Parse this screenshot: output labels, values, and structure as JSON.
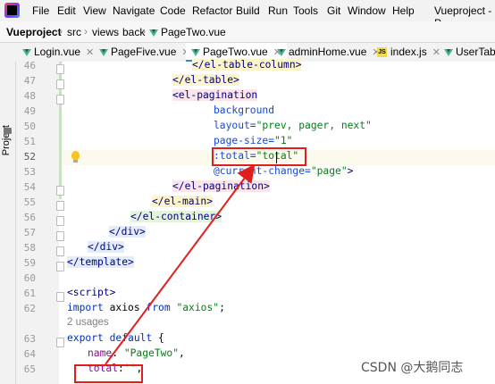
{
  "menu": {
    "items": [
      "File",
      "Edit",
      "View",
      "Navigate",
      "Code",
      "Refactor",
      "Build",
      "Run",
      "Tools",
      "Git",
      "Window",
      "Help"
    ],
    "window_title": "Vueproject - P"
  },
  "breadcrumb": {
    "project": "Vueproject",
    "parts": [
      "src",
      "views",
      "back"
    ],
    "file": "PageTwo.vue"
  },
  "tabs": [
    {
      "label": "Login.vue",
      "icon": "vue-file-icon"
    },
    {
      "label": "PageFive.vue",
      "icon": "vue-file-icon"
    },
    {
      "label": "PageTwo.vue",
      "icon": "vue-file-icon",
      "active": true
    },
    {
      "label": "adminHome.vue",
      "icon": "vue-file-icon"
    },
    {
      "label": "index.js",
      "icon": "js-file-icon"
    },
    {
      "label": "UserTabl",
      "icon": "vue-file-icon"
    }
  ],
  "sidebar": {
    "project_label": "Project"
  },
  "editor": {
    "line_numbers": [
      "46",
      "47",
      "48",
      "49",
      "50",
      "51",
      "52",
      "53",
      "54",
      "55",
      "56",
      "57",
      "58",
      "59",
      "60",
      "61",
      "62",
      "",
      "63",
      "64",
      "65"
    ],
    "current_line": "52",
    "code": {
      "l46": "</el-table-column>",
      "l47": "</el-table>",
      "l48_tag": "<el-pagination",
      "l49": "background",
      "l50_attr": "layout=",
      "l50_val": "\"prev, pager, next\"",
      "l51_attr": "page-size=",
      "l51_val": "\"1\"",
      "l52_attr": ":total=",
      "l52_val": "\"total\"",
      "l53_attr": "@current-change=",
      "l53_val": "\"page\"",
      "l53_end": ">",
      "l54": "</el-pagination>",
      "l55": "</el-main>",
      "l56": "</el-container>",
      "l57": "</div>",
      "l58": "</div>",
      "l59": "</template>",
      "l60": "",
      "l61": "<script>",
      "l62_kw1": "import",
      "l62_id": " axios ",
      "l62_kw2": "from",
      "l62_str": " \"axios\"",
      "l62_end": ";",
      "usages": "2 usages",
      "l63_kw1": "export",
      "l63_kw2": " default",
      "l63_end": " {",
      "l64_prop": "name",
      "l64_colon": ": ",
      "l64_str": "\"PageTwo\"",
      "l64_end": ",",
      "l65_prop": "total",
      "l65_colon": ":",
      "l65_str": "''",
      "l65_end": ","
    }
  },
  "annotation": {
    "color": "#e01e1e"
  },
  "watermark": "CSDN @大鹅同志"
}
